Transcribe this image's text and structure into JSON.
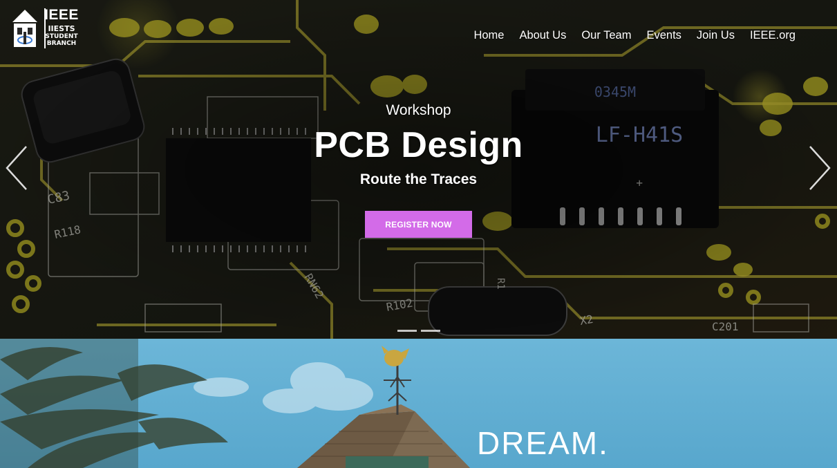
{
  "brand": {
    "line1": "IEEE",
    "line2": "IIESTS",
    "line3": "STUDENT",
    "line4": "BRANCH",
    "logo_icon": "ieee-building-logo"
  },
  "nav": {
    "items": [
      {
        "label": "Home"
      },
      {
        "label": "About Us"
      },
      {
        "label": "Our Team"
      },
      {
        "label": "Events"
      },
      {
        "label": "Join Us"
      },
      {
        "label": "IEEE.org"
      }
    ]
  },
  "slide": {
    "kicker": "Workshop",
    "title": "PCB Design",
    "subtitle": "Route the Traces",
    "cta_label": "REGISTER NOW",
    "prev_icon": "chevron-left-icon",
    "next_icon": "chevron-right-icon",
    "indicator_count": 2
  },
  "section2": {
    "headline": "DREAM."
  },
  "colors": {
    "cta": "#d36be8",
    "sky": "#5eaed4",
    "pcb_trace": "#c9b92f"
  }
}
